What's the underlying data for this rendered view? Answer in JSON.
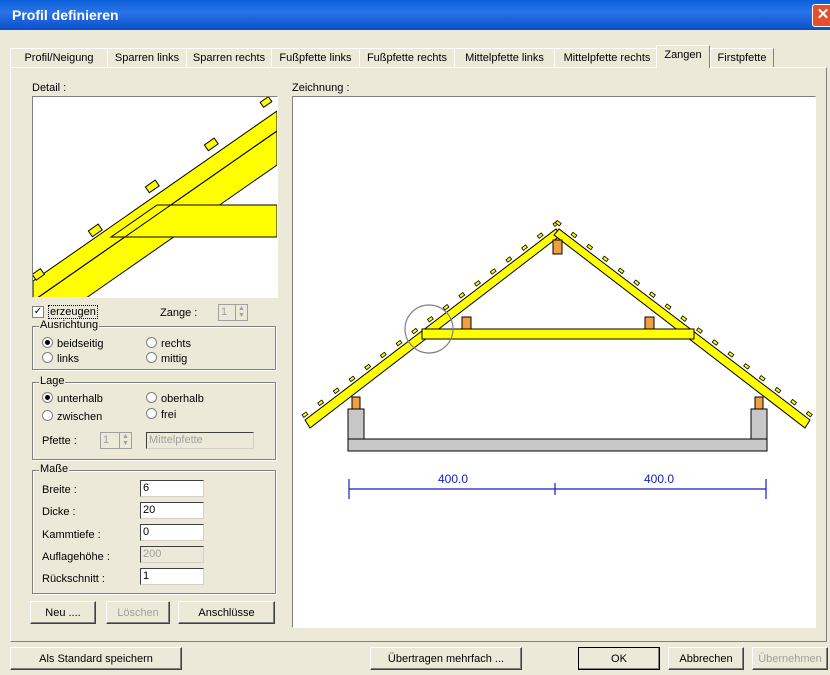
{
  "window": {
    "title": "Profil definieren",
    "close_icon": "close-icon"
  },
  "tabs": [
    {
      "label": "Profil/Neigung"
    },
    {
      "label": "Sparren links"
    },
    {
      "label": "Sparren rechts"
    },
    {
      "label": "Fußpfette links"
    },
    {
      "label": "Fußpfette rechts"
    },
    {
      "label": "Mittelpfette links"
    },
    {
      "label": "Mittelpfette rechts"
    },
    {
      "label": "Zangen"
    },
    {
      "label": "Firstpfette"
    }
  ],
  "active_tab": "Zangen",
  "detail": {
    "label": "Detail :"
  },
  "drawing": {
    "label": "Zeichnung :",
    "dim_left": "400.0",
    "dim_right": "400.0"
  },
  "erzeugen": {
    "label": "erzeugen",
    "checked": true
  },
  "zange": {
    "label": "Zange :",
    "value": "1"
  },
  "ausrichtung": {
    "legend": "Ausrichtung",
    "beidseitig": "beidseitig",
    "rechts": "rechts",
    "links": "links",
    "mittig": "mittig",
    "selected": "beidseitig"
  },
  "lage": {
    "legend": "Lage",
    "unterhalb": "unterhalb",
    "oberhalb": "oberhalb",
    "zwischen": "zwischen",
    "frei": "frei",
    "selected": "unterhalb",
    "pfette_label": "Pfette :",
    "pfette_value": "1",
    "pfette_name": "Mittelpfette"
  },
  "masse": {
    "legend": "Maße",
    "breite_label": "Breite :",
    "breite": "6",
    "dicke_label": "Dicke :",
    "dicke": "20",
    "kammtiefe_label": "Kammtiefe :",
    "kammtiefe": "0",
    "auflagehoehe_label": "Auflagehöhe :",
    "auflagehoehe": "200",
    "rueckschnitt_label": "Rückschnitt :",
    "rueckschnitt": "1"
  },
  "buttons": {
    "neu": "Neu ....",
    "loeschen": "Löschen",
    "anschluesse": "Anschlüsse",
    "als_standard": "Als Standard speichern",
    "uebertragen": "Übertragen mehrfach ...",
    "ok": "OK",
    "abbrechen": "Abbrechen",
    "uebernehmen": "Übernehmen"
  }
}
